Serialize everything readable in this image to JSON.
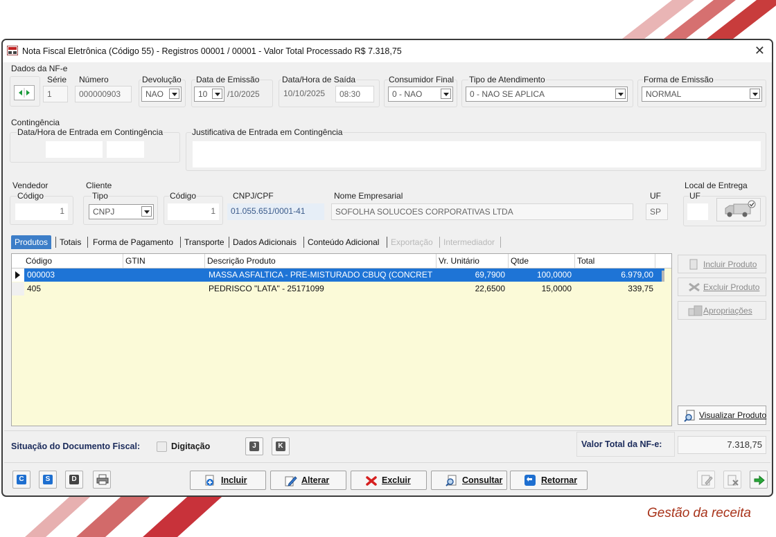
{
  "window": {
    "title": "Nota Fiscal Eletrônica (Código 55) - Registros 00001 / 00001 - Valor Total Processado R$ 7.318,75",
    "close_glyph": "✕"
  },
  "nfe": {
    "group_label": "Dados da NF-e",
    "serie_label": "Série",
    "serie": "1",
    "numero_label": "Número",
    "numero": "000000903",
    "devolucao_label": "Devolução",
    "devolucao": "NAO",
    "data_emissao_label": "Data de Emissão",
    "dia_emissao": "10",
    "mes_ano_emissao": "/10/2025",
    "saida_label": "Data/Hora de Saída",
    "data_saida": "10/10/2025",
    "hora_saida": "08:30",
    "consumidor_label": "Consumidor Final",
    "consumidor": "0 - NAO",
    "atendimento_label": "Tipo de Atendimento",
    "atendimento": "0 - NAO SE APLICA",
    "forma_label": "Forma de Emissão",
    "forma": "NORMAL"
  },
  "contingencia": {
    "group_label": "Contingência",
    "entrada_label": "Data/Hora de Entrada em Contingência",
    "justificativa_label": "Justificativa de Entrada em Contingência",
    "data": "",
    "hora": "",
    "justificativa": ""
  },
  "vendedor": {
    "group_label": "Vendedor",
    "codigo_label": "Código",
    "codigo": "1"
  },
  "cliente": {
    "group_label": "Cliente",
    "tipo_label": "Tipo",
    "tipo": "CNPJ",
    "codigo_label": "Código",
    "codigo": "1",
    "cnpj_label": "CNPJ/CPF",
    "cnpj": "01.055.651/0001-41",
    "nome_label": "Nome Empresarial",
    "nome": "SOFOLHA SOLUCOES CORPORATIVAS LTDA",
    "uf_label": "UF",
    "uf": "SP"
  },
  "entrega": {
    "group_label": "Local de Entrega",
    "uf_label": "UF",
    "uf": ""
  },
  "tabs": [
    {
      "label": "Produtos",
      "state": "active"
    },
    {
      "label": "Totais",
      "state": "normal"
    },
    {
      "label": "Forma de Pagamento",
      "state": "normal"
    },
    {
      "label": "Transporte",
      "state": "normal"
    },
    {
      "label": "Dados Adicionais",
      "state": "normal"
    },
    {
      "label": "Conteúdo Adicional",
      "state": "normal"
    },
    {
      "label": "Exportação",
      "state": "disabled"
    },
    {
      "label": "Intermediador",
      "state": "disabled"
    }
  ],
  "grid": {
    "columns": [
      "Código",
      "GTIN",
      "Descrição Produto",
      "Vr. Unitário",
      "Qtde",
      "Total"
    ],
    "rows": [
      {
        "codigo": "000003",
        "gtin": "",
        "descricao": "MASSA ASFALTICA - PRE-MISTURADO CBUQ (CONCRET",
        "unitario": "69,7900",
        "qtde": "100,0000",
        "total": "6.979,00"
      },
      {
        "codigo": "405",
        "gtin": "",
        "descricao": "PEDRISCO \"LATA\" - 25171099",
        "unitario": "22,6500",
        "qtde": "15,0000",
        "total": "339,75"
      }
    ]
  },
  "side_actions": {
    "incluir": "Incluir Produto",
    "excluir": "Excluir Produto",
    "apropriacoes": "Apropriações",
    "visualizar": "Visualizar Produto"
  },
  "status": {
    "label": "Situação do Documento Fiscal:",
    "value": "Digitação",
    "btn_j": "J",
    "btn_k": "K",
    "total_label": "Valor Total da NF-e:",
    "total": "7.318,75"
  },
  "toolbar": {
    "c": "C",
    "s": "S",
    "d": "D",
    "incluir": "Incluir",
    "alterar": "Alterar",
    "excluir": "Excluir",
    "consultar": "Consultar",
    "retornar": "Retornar"
  },
  "colors": {
    "accent": "#1e74d6",
    "grid_bg": "#fbfad8",
    "brand_red": "#a8331a"
  },
  "footer": {
    "caption": "Gestão da receita"
  }
}
